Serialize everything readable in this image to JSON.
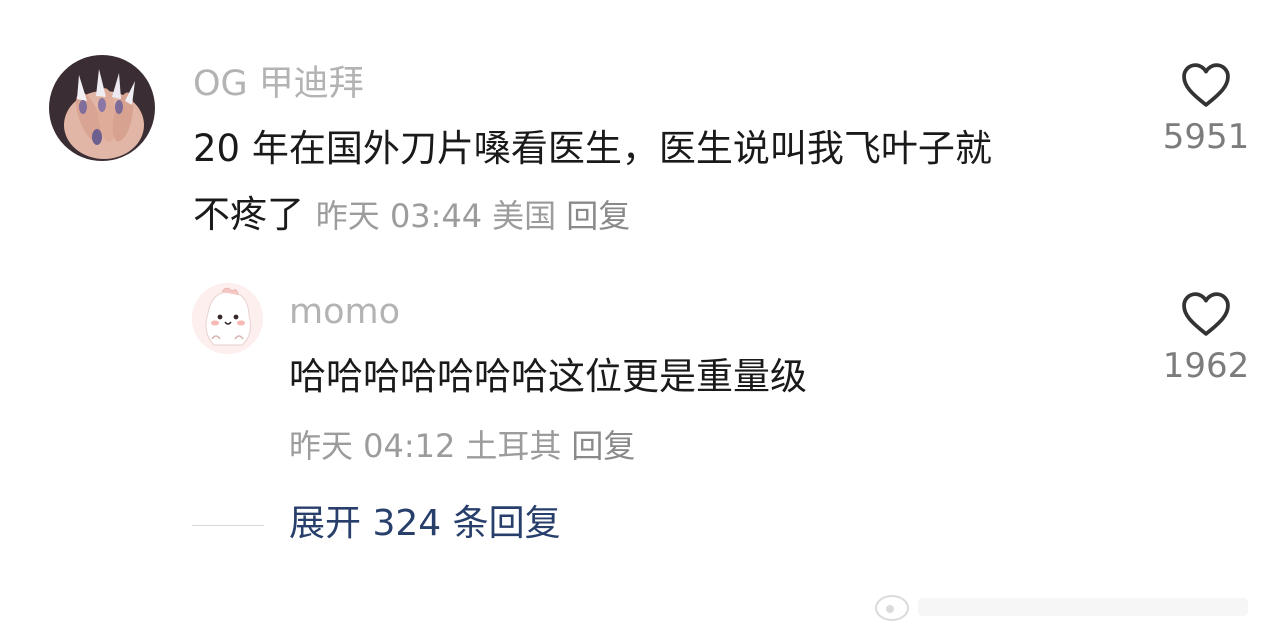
{
  "comment": {
    "username": "OG 甲迪拜",
    "text_line1": "20 年在国外刀片嗓看医生，医生说叫我飞叶子就",
    "text_line2": "不疼了",
    "time": "昨天 03:44",
    "location": "美国",
    "reply_label": "回复",
    "likes": "5951"
  },
  "reply": {
    "username": "momo",
    "text": "哈哈哈哈哈哈哈这位更是重量级",
    "time": "昨天 04:12",
    "location": "土耳其",
    "reply_label": "回复",
    "likes": "1962"
  },
  "expand_replies": {
    "label": "展开 324 条回复"
  },
  "icons": {
    "like": "heart-outline-icon"
  },
  "colors": {
    "username": "#b3b3b3",
    "body_text": "#1a1a1a",
    "meta": "#9c9c9c",
    "expand_link": "#283f6b"
  }
}
